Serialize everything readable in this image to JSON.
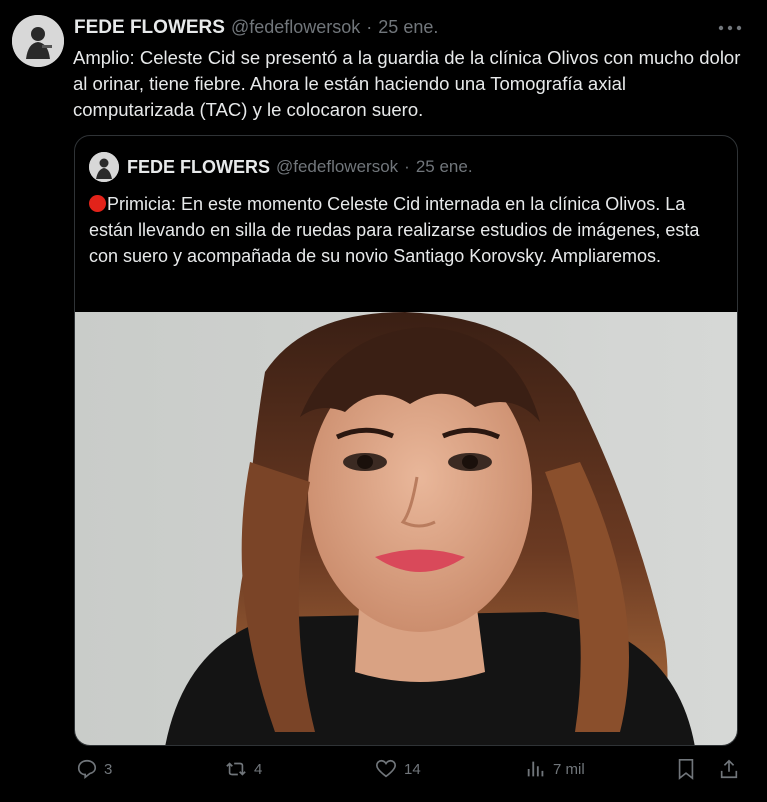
{
  "tweet": {
    "author_name": "FEDE FLOWERS",
    "handle": "@fedeflowersok",
    "separator": "·",
    "date": "25 ene.",
    "text": "Amplio: Celeste Cid se presentó a la guardia de la clínica Olivos con mucho dolor al orinar, tiene fiebre. Ahora le están haciendo una Tomografía axial computarizada (TAC) y le colocaron suero."
  },
  "quote": {
    "author_name": "FEDE FLOWERS",
    "handle": "@fedeflowersok",
    "separator": "·",
    "date": "25 ene.",
    "emoji": "red-circle-icon",
    "text": "Primicia: En este momento Celeste Cid internada en la clínica Olivos. La están llevando en silla de ruedas para realizarse estudios de imágenes, esta con suero y acompañada de su novio Santiago Korovsky. Ampliaremos."
  },
  "actions": {
    "replies": "3",
    "reposts": "4",
    "likes": "14",
    "views": "7 mil"
  },
  "colors": {
    "background": "#000000",
    "text": "#e7e9ea",
    "secondary": "#71767b",
    "border": "#2f3336",
    "red_dot": "#e2231a"
  }
}
